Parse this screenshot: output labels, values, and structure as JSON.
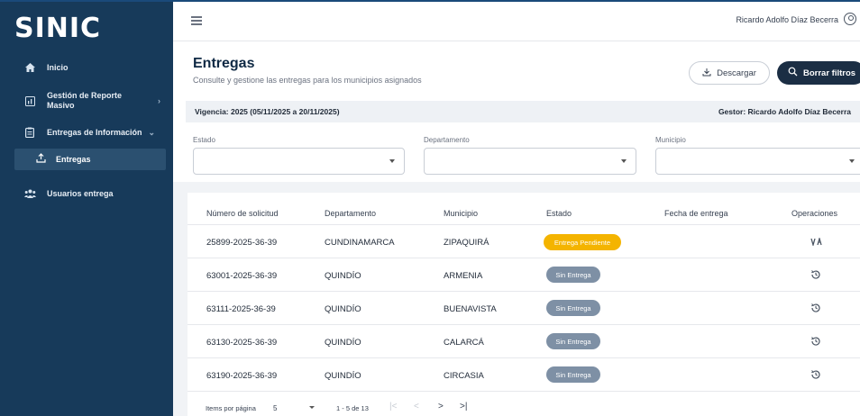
{
  "app": {
    "logo": "SINIC"
  },
  "sidebar": {
    "items": [
      {
        "label": "Inicio",
        "icon": "home-icon"
      },
      {
        "label": "Gestión de Reporte",
        "label2": "Masivo",
        "icon": "report-icon"
      },
      {
        "label": "Entregas de Información",
        "icon": "clipboard-icon"
      },
      {
        "label": "Entregas",
        "icon": "upload-icon"
      },
      {
        "label": "Usuarios entrega",
        "icon": "users-icon"
      }
    ]
  },
  "header": {
    "user_name": "Ricardo Adolfo Díaz Becerra"
  },
  "page": {
    "title": "Entregas",
    "subtitle": "Consulte y gestione las entregas para los municipios asignados",
    "download_label": "Descargar",
    "clear_filters_label": "Borrar filtros"
  },
  "info": {
    "vigencia": "Vigencia: 2025 (05/11/2025 a 20/11/2025)",
    "gestor": "Gestor: Ricardo Adolfo Díaz Becerra"
  },
  "filters": {
    "estado_label": "Estado",
    "departamento_label": "Departamento",
    "municipio_label": "Municipio"
  },
  "table": {
    "headers": [
      "Número de solicitud",
      "Departamento",
      "Municipio",
      "Estado",
      "Fecha de entrega",
      "Operaciones"
    ],
    "rows": [
      {
        "solicitud": "25899-2025-36-39",
        "departamento": "CUNDINAMARCA",
        "municipio": "ZIPAQUIRÁ",
        "estado": "Entrega Pendiente",
        "fecha": "",
        "op_icon": "deliver-icon"
      },
      {
        "solicitud": "63001-2025-36-39",
        "departamento": "QUINDÍO",
        "municipio": "ARMENIA",
        "estado": "Sin Entrega",
        "fecha": "",
        "op_icon": "history-icon"
      },
      {
        "solicitud": "63111-2025-36-39",
        "departamento": "QUINDÍO",
        "municipio": "BUENAVISTA",
        "estado": "Sin Entrega",
        "fecha": "",
        "op_icon": "history-icon"
      },
      {
        "solicitud": "63130-2025-36-39",
        "departamento": "QUINDÍO",
        "municipio": "CALARCÁ",
        "estado": "Sin Entrega",
        "fecha": "",
        "op_icon": "history-icon"
      },
      {
        "solicitud": "63190-2025-36-39",
        "departamento": "QUINDÍO",
        "municipio": "CIRCASIA",
        "estado": "Sin Entrega",
        "fecha": "",
        "op_icon": "history-icon"
      }
    ]
  },
  "paginator": {
    "items_label": "Items por página",
    "page_size": "5",
    "range": "1 - 5 de 13",
    "first": "|<",
    "prev": "<",
    "next": ">",
    "last": ">|"
  },
  "colors": {
    "sidebar_bg": "#173a5a",
    "primary_button": "#1b2e44",
    "badge_pending": "#f4b400",
    "badge_none": "#7e90a5"
  }
}
